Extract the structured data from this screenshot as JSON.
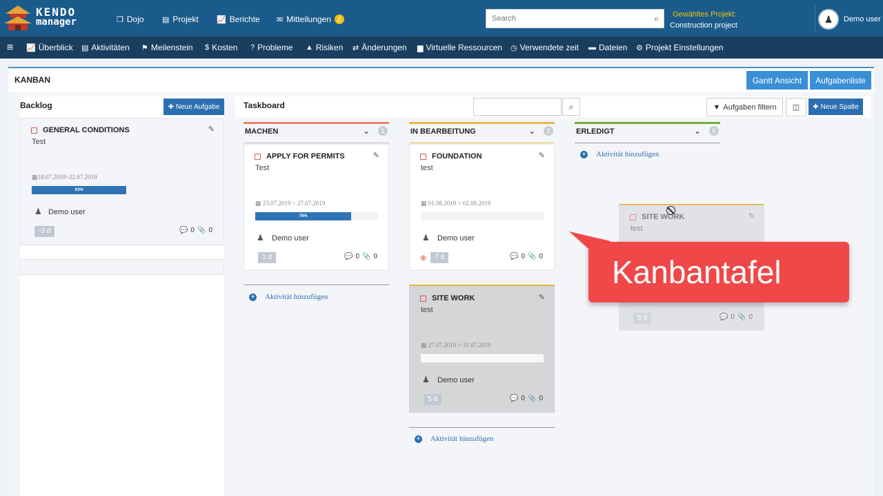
{
  "app": {
    "logo_line1": "KENDO",
    "logo_line2": "manager"
  },
  "topnav": {
    "items": [
      {
        "label": "Dojo",
        "icon": "copy-icon"
      },
      {
        "label": "Projekt",
        "icon": "file-icon"
      },
      {
        "label": "Berichte",
        "icon": "chart-icon"
      },
      {
        "label": "Mitteilungen",
        "icon": "envelope-icon",
        "badge": "2"
      }
    ],
    "search_placeholder": "Search",
    "project_label": "Gewähltes Projekt:",
    "project_name": "Construction project",
    "user": "Demo user"
  },
  "subnav": {
    "items": [
      {
        "label": "Überblick"
      },
      {
        "label": "Aktivitäten"
      },
      {
        "label": "Meilenstein"
      },
      {
        "label": "Kosten"
      },
      {
        "label": "Probleme"
      },
      {
        "label": "Risiken"
      },
      {
        "label": "Änderungen"
      },
      {
        "label": "Virtuelle Ressourcen"
      },
      {
        "label": "Verwendete zeit"
      },
      {
        "label": "Dateien"
      },
      {
        "label": "Projekt Einstellungen"
      }
    ]
  },
  "page": {
    "title": "KANBAN",
    "gantt_button": "Gantt Ansicht",
    "tasklist_button": "Aufgabenliste"
  },
  "backlog": {
    "title": "Backlog",
    "new_task_button": "Neue Aufgabe",
    "cards": [
      {
        "title": "GENERAL CONDITIONS",
        "desc": "Test",
        "dates": "18.07.2019>22.07.2019",
        "progress_label": "63%",
        "progress": 0.63,
        "user": "Demo user",
        "days": "-3 d",
        "comments": "0",
        "attachments": "0"
      }
    ]
  },
  "taskboard": {
    "title": "Taskboard",
    "filter_button": "Aufgaben filtern",
    "new_column_button": "Neue Spalte",
    "add_activity": "Aktivität hinzufügen",
    "columns": [
      {
        "name": "MACHEN",
        "count": "1",
        "color": "#f0826b",
        "cards": [
          {
            "title": "APPLY FOR PERMITS",
            "desc": "Test",
            "dates": "23.07.2019 > 27.07.2019",
            "progress_label": "78%",
            "progress": 0.78,
            "user": "Demo user",
            "days": "1 d",
            "comments": "0",
            "attachments": "0"
          }
        ]
      },
      {
        "name": "IN BEARBEITUNG",
        "count": "2",
        "color": "#e8b84a",
        "cards": [
          {
            "title": "FOUNDATION",
            "desc": "test",
            "dates": "01.08.2019 > 02.08.2019",
            "progress": 0,
            "user": "Demo user",
            "days": "7 d",
            "comments": "0",
            "attachments": "0"
          },
          {
            "title": "SITE WORK",
            "desc": "test",
            "dates": "27.07.2019 > 31.07.2019",
            "progress": 0,
            "user": "Demo user",
            "days": "5 d",
            "comments": "0",
            "attachments": "0"
          }
        ]
      },
      {
        "name": "ERLEDIGT",
        "count": "0",
        "color": "#6fae3e",
        "cards": []
      }
    ],
    "dragging_card": {
      "title": "SITE WORK",
      "desc": "test",
      "days": "5 d",
      "comments": "0",
      "attachments": "0"
    }
  },
  "callout": {
    "text": "Kanbantafel"
  }
}
